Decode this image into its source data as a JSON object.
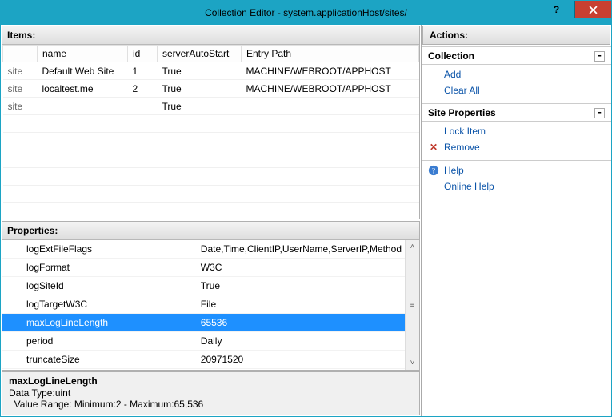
{
  "window": {
    "title": "Collection Editor - system.applicationHost/sites/"
  },
  "itemsPanel": {
    "heading": "Items:",
    "columns": {
      "c0": "",
      "c1": "name",
      "c2": "id",
      "c3": "serverAutoStart",
      "c4": "Entry Path"
    },
    "rows": [
      {
        "key": "site",
        "name": "Default Web Site",
        "id": "1",
        "auto": "True",
        "path": "MACHINE/WEBROOT/APPHOST"
      },
      {
        "key": "site",
        "name": "localtest.me",
        "id": "2",
        "auto": "True",
        "path": "MACHINE/WEBROOT/APPHOST"
      },
      {
        "key": "site",
        "name": "",
        "id": "",
        "auto": "True",
        "path": ""
      }
    ]
  },
  "propsPanel": {
    "heading": "Properties:",
    "rows": [
      {
        "name": "logExtFileFlags",
        "value": "Date,Time,ClientIP,UserName,ServerIP,Method"
      },
      {
        "name": "logFormat",
        "value": "W3C"
      },
      {
        "name": "logSiteId",
        "value": "True"
      },
      {
        "name": "logTargetW3C",
        "value": "File"
      },
      {
        "name": "maxLogLineLength",
        "value": "65536",
        "selected": true
      },
      {
        "name": "period",
        "value": "Daily"
      },
      {
        "name": "truncateSize",
        "value": "20971520"
      }
    ],
    "groupRow": "name"
  },
  "description": {
    "title": "maxLogLineLength",
    "line1": "Data Type:uint",
    "line2": "  Value Range: Minimum:2 - Maximum:65,536"
  },
  "actions": {
    "heading": "Actions:",
    "collection": {
      "title": "Collection",
      "add": "Add",
      "clear": "Clear All"
    },
    "siteProps": {
      "title": "Site Properties",
      "lock": "Lock Item",
      "remove": "Remove"
    },
    "help": {
      "help": "Help",
      "online": "Online Help"
    }
  }
}
